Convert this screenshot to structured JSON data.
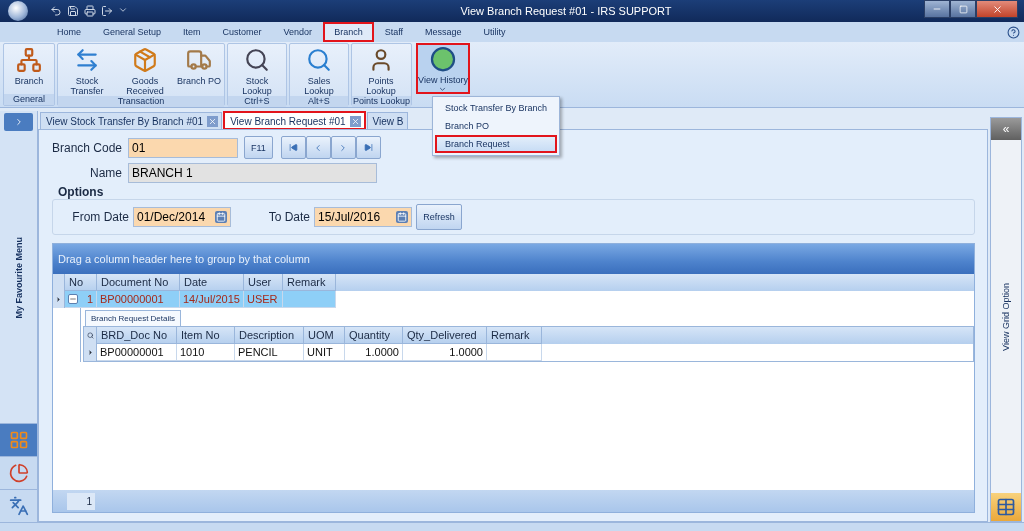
{
  "window": {
    "title": "View Branch Request #01 - IRS SUPPORT"
  },
  "menu_tabs": [
    {
      "label": "Home",
      "selected": false,
      "highlighted": false
    },
    {
      "label": "General Setup",
      "selected": false,
      "highlighted": false
    },
    {
      "label": "Item",
      "selected": false,
      "highlighted": false
    },
    {
      "label": "Customer",
      "selected": false,
      "highlighted": false
    },
    {
      "label": "Vendor",
      "selected": false,
      "highlighted": false
    },
    {
      "label": "Branch",
      "selected": true,
      "highlighted": true
    },
    {
      "label": "Staff",
      "selected": false,
      "highlighted": false
    },
    {
      "label": "Message",
      "selected": false,
      "highlighted": false
    },
    {
      "label": "Utility",
      "selected": false,
      "highlighted": false
    }
  ],
  "ribbon_groups": [
    {
      "label": "General",
      "buttons": [
        {
          "label": "Branch",
          "kind": "network",
          "highlighted": false
        }
      ]
    },
    {
      "label": "Transaction",
      "buttons": [
        {
          "label": "Stock Transfer",
          "kind": "transfer",
          "highlighted": false
        },
        {
          "label": "Goods Received",
          "kind": "box",
          "highlighted": false
        },
        {
          "label": "Branch PO",
          "kind": "truck",
          "highlighted": false
        }
      ]
    },
    {
      "label": "Ctrl+S",
      "buttons": [
        {
          "label": "Stock Lookup",
          "kind": "lookup",
          "highlighted": false
        }
      ]
    },
    {
      "label": "Alt+S",
      "buttons": [
        {
          "label": "Sales Lookup",
          "kind": "search",
          "highlighted": false
        }
      ]
    },
    {
      "label": "Points Lookup",
      "buttons": [
        {
          "label": "Points Lookup",
          "kind": "person",
          "highlighted": false
        }
      ]
    }
  ],
  "view_history": {
    "label": "View History",
    "highlighted": true
  },
  "history_menu": [
    {
      "label": "Stock Transfer By Branch",
      "highlighted": false
    },
    {
      "label": "Branch PO",
      "highlighted": false
    },
    {
      "label": "Branch Request",
      "highlighted": true
    }
  ],
  "doc_tabs": [
    {
      "label": "View Stock Transfer By Branch #01",
      "selected": false,
      "highlighted": false,
      "closable": true
    },
    {
      "label": "View Branch Request #01",
      "selected": true,
      "highlighted": true,
      "closable": true
    },
    {
      "label": "View B",
      "selected": false,
      "highlighted": false,
      "closable": false
    }
  ],
  "sidebar": {
    "title": "My Favourite Menu"
  },
  "form": {
    "branch_code": {
      "label": "Branch Code",
      "value": "01"
    },
    "lookup_button": "F11",
    "name": {
      "label": "Name",
      "value": "BRANCH 1"
    }
  },
  "options": {
    "title": "Options",
    "from_date": {
      "label": "From Date",
      "value": "01/Dec/2014"
    },
    "to_date": {
      "label": "To Date",
      "value": "15/Jul/2016"
    },
    "refresh_button": "Refresh"
  },
  "grid": {
    "group_panel": "Drag a column header here to group by that column",
    "columns": [
      "No",
      "Document No",
      "Date",
      "User",
      "Remark"
    ],
    "rows": [
      {
        "cells": [
          "1",
          "BP00000001",
          "14/Jul/2015",
          "USER",
          ""
        ],
        "selected": true,
        "expanded": true
      }
    ],
    "detail": {
      "tab": "Branch Request Details",
      "columns": [
        "BRD_Doc No",
        "Item No",
        "Description",
        "UOM",
        "Quantity",
        "Qty_Delivered",
        "Remark"
      ],
      "rows": [
        {
          "cells": [
            "BP00000001",
            "1010",
            "PENCIL",
            "UNIT",
            "1.0000",
            "1.0000",
            ""
          ]
        }
      ]
    },
    "footer_count": "1"
  },
  "right_panel": {
    "collapse_button": "«",
    "title": "View Grid Option"
  }
}
